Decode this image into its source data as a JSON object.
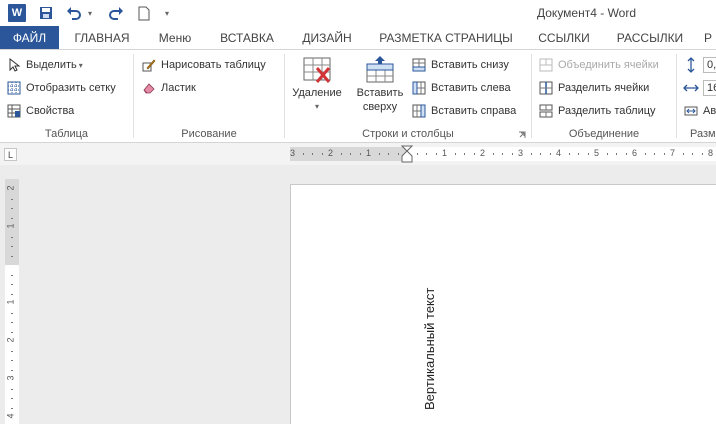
{
  "window": {
    "title": "Документ4 - Word"
  },
  "qat": {
    "icons": [
      "word-logo-icon",
      "save-icon",
      "undo-icon",
      "redo-icon",
      "new-document-icon",
      "customize-qat-icon"
    ]
  },
  "tabs": {
    "file": "ФАЙЛ",
    "home": "ГЛАВНАЯ",
    "menu": "Меню",
    "insert": "ВСТАВКА",
    "design": "ДИЗАЙН",
    "layout": "РАЗМЕТКА СТРАНИЦЫ",
    "references": "ССЫЛКИ",
    "mailings": "РАССЫЛКИ",
    "review": "Р"
  },
  "ribbon": {
    "table_group": {
      "label": "Таблица",
      "select": "Выделить",
      "gridlines": "Отобразить сетку",
      "properties": "Свойства"
    },
    "draw_group": {
      "label": "Рисование",
      "draw_table": "Нарисовать таблицу",
      "eraser": "Ластик"
    },
    "rows_cols_group": {
      "label": "Строки и столбцы",
      "delete": "Удаление",
      "insert_above_1": "Вставить",
      "insert_above_2": "сверху",
      "insert_below": "Вставить снизу",
      "insert_left": "Вставить слева",
      "insert_right": "Вставить справа"
    },
    "merge_group": {
      "label": "Объединение",
      "merge_cells": "Объединить ячейки",
      "split_cells": "Разделить ячейки",
      "split_table": "Разделить таблицу"
    },
    "size_group": {
      "label": "Разм",
      "height_value": "0,",
      "width_value": "16",
      "autofit": "Ав"
    }
  },
  "ruler": {
    "tab_selector": "L",
    "horizontal_numbers": [
      "3",
      "2",
      "1",
      "1",
      "2",
      "3",
      "4",
      "5",
      "6",
      "7",
      "8"
    ],
    "vertical_numbers": [
      "2",
      "1",
      "1",
      "2",
      "3",
      "4"
    ]
  },
  "document": {
    "vertical_text": "Вертикальный текст"
  },
  "colors": {
    "accent": "#2b579a",
    "ribbon_bg": "#ffffff",
    "workspace_bg": "#ececec"
  }
}
